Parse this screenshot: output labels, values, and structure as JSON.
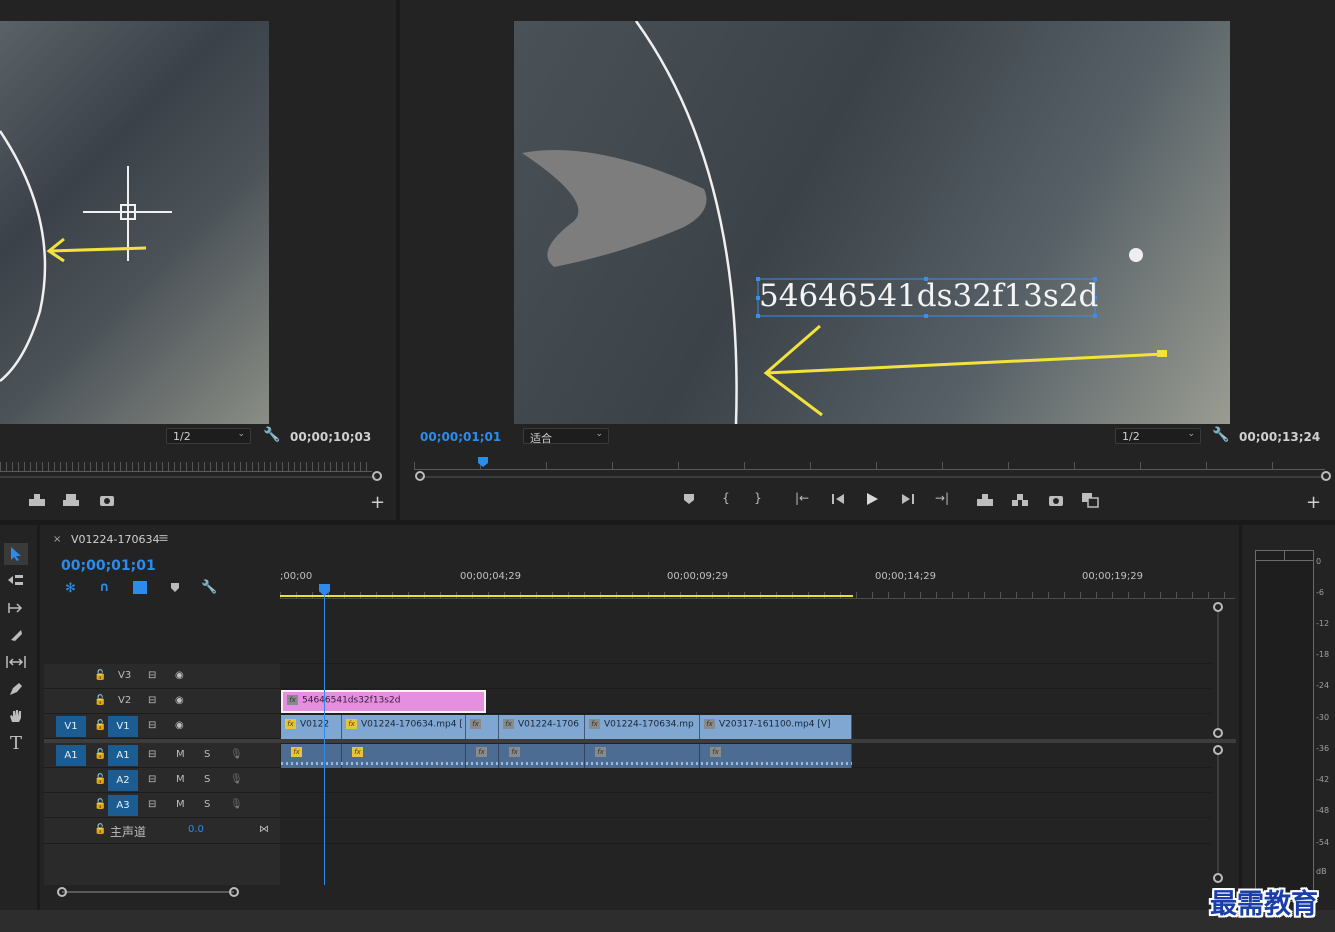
{
  "source_monitor": {
    "resolution": "1/2",
    "timecode": "00;00;10;03"
  },
  "program_monitor": {
    "timecode_current": "00;00;01;01",
    "fit": "适合",
    "resolution": "1/2",
    "timecode_duration": "00;00;13;24",
    "title_overlay": "54646541ds32f13s2d"
  },
  "timeline": {
    "close_glyph": "×",
    "sequence_name": "V01224-170634",
    "menu_glyph": "≡",
    "timecode": "00;00;01;01",
    "ruler_labels": [
      ";00;00",
      "00;00;04;29",
      "00;00;09;29",
      "00;00;14;29",
      "00;00;19;29"
    ],
    "tracks": {
      "v3": "V3",
      "v2": "V2",
      "v1": "V1",
      "v1_source": "V1",
      "a1": "A1",
      "a1_source": "A1",
      "a2": "A2",
      "a3": "A3",
      "mute": "M",
      "solo": "S",
      "master_label": "主声道",
      "master_value": "0.0"
    },
    "title_clip": "54646541ds32f13s2d",
    "video_clips": [
      "V0122",
      "V01224-170634.mp4 [",
      "",
      "V01224-1706",
      "V01224-170634.mp",
      "V20317-161100.mp4 [V]"
    ],
    "fx_label": "fx"
  },
  "audio_meter": {
    "labels": [
      "0",
      "-6",
      "-12",
      "-18",
      "-24",
      "-30",
      "-36",
      "-42",
      "-48",
      "-54",
      "dB"
    ]
  },
  "watermark": "最需教育",
  "colors": {
    "accent_blue": "#2d8ceb",
    "target_blue": "#1b5c92",
    "video_clip": "#7fa7d2",
    "audio_clip": "#4c6c93",
    "title_clip": "#e58fe0",
    "work_area": "#e5e03a",
    "yellow_arrow": "#f2e23a"
  }
}
